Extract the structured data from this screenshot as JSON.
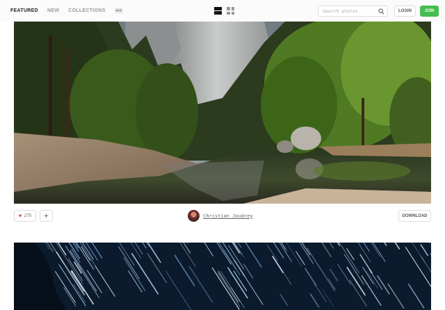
{
  "header": {
    "nav": [
      {
        "label": "FEATURED",
        "active": true
      },
      {
        "label": "NEW",
        "active": false
      },
      {
        "label": "COLLECTIONS",
        "active": false
      }
    ],
    "more_icon": "ellipsis-icon",
    "view_modes": [
      "list-view-icon",
      "grid-view-icon"
    ],
    "search": {
      "placeholder": "Search photos",
      "icon": "search-icon"
    },
    "login_label": "LOGIN",
    "join_label": "JOIN"
  },
  "photo": {
    "likes": "275",
    "like_icon": "heart-icon",
    "add_icon": "plus-icon",
    "author": "Christian Joudrey",
    "download_label": "DOWNLOAD"
  },
  "colors": {
    "join_green": "#46bd4f",
    "heart_red": "#e1483f"
  }
}
